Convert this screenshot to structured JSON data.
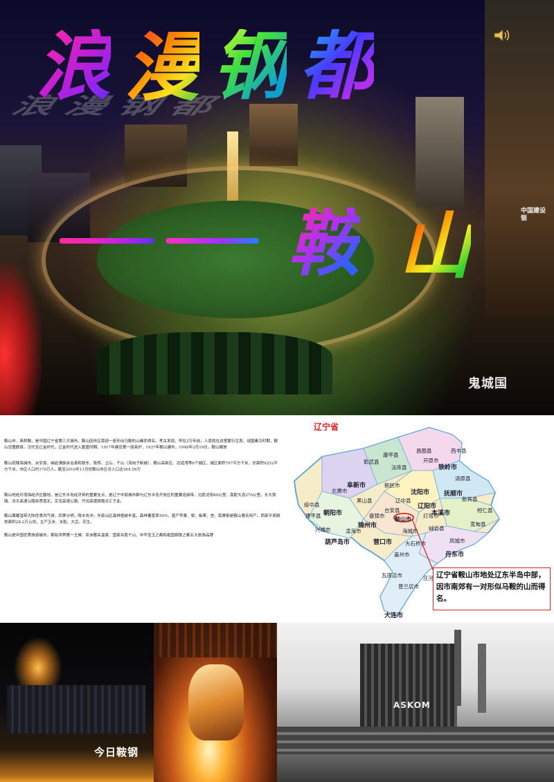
{
  "hero": {
    "title_chars": [
      "浪",
      "漫",
      "钢",
      "都"
    ],
    "subtitle_dash": "——",
    "subtitle_chars": [
      "鞍",
      "山"
    ],
    "logo_text": "鬼城国",
    "bank_sign": "中国建设银"
  },
  "text": {
    "para1": "鞍山市，简称鞍，是中国辽宁省第三大城市，鞍山因市区南部一座形似马鞍的山峰而得名。考古发现，早在2万年前，人类就在这里繁衍生息。战国秦汉时期，鞍山设置郡县。汉代至辽金时代，辽金时代进入繁盛时期。1917年建设第一座高炉，1937年鞍山建市，1948年2月19日，鞍山解放",
    "para2": "鞍山现辖海城市、台安县、岫岩满族自治县和铁东、铁西、立山、千山（汤岗子新城）、鞍山高新区、达道湾等6个城区，城区面积797平方千米，总面积9252平方千米，市区人口约170万人，截至2010年11月份鞍山市区总人口达364.59万",
    "para3": "鞍山地处环渤海经济区腹地，是辽东半岛经济带的重要支点，是辽宁中部城市群与辽东半岛开放区的重要连接带，北距沈阳89公里，南距大连270公里，长大铁路、沈大高速公路纵贯南北，京沈高速公路、丹沈高速铁路交汇于此。",
    "para4": "鞍山属暖温带大陆性季风气候，四季分明，降水充沛。东部山区森林植被丰富，森林覆盖率50%，盛产苹果、梨、板栗、杏、南果梨是鞍山著名特产。西部平原耕地面积28.2万公顷，主产玉米、水稻、大豆、花生。",
    "para5": "鞍山是中国优秀旅游城市，拥有世界第一玉佛、亚洲著名温泉、国家名胜千山、中华宝玉之都和祖国钢铁之都五大旅游品牌"
  },
  "map": {
    "title": "辽宁省",
    "labels": [
      "阜新市",
      "沈阳市",
      "抚顺市",
      "铁岭市",
      "朝阳市",
      "锦州市",
      "鞍山市",
      "本溪市",
      "辽阳市",
      "葫芦岛市",
      "营口市",
      "丹东市",
      "大连市",
      "新民市",
      "彰武县",
      "昌图县",
      "西丰县",
      "开原市",
      "新宾县",
      "清原县",
      "北票市",
      "凌海市",
      "盘锦市",
      "海城市",
      "岫岩县",
      "凤城市",
      "宽甸县",
      "庄河市",
      "瓦房店市",
      "普兰店市",
      "台安县",
      "黑山县",
      "建平县",
      "兴城市",
      "绥中县",
      "盖州市",
      "大石桥市",
      "法库县",
      "康平县",
      "辽中县",
      "灯塔市",
      "桓仁县"
    ],
    "callout": "辽宁省鞍山市地处辽东半岛中部，因市南郊有一对形似马鞍的山而得名。"
  },
  "photos": {
    "caption": "今日鞍钢",
    "sign": "ASKOM"
  },
  "colors": {
    "callout_border": "#dd2222",
    "map_title": "#dd2222"
  }
}
